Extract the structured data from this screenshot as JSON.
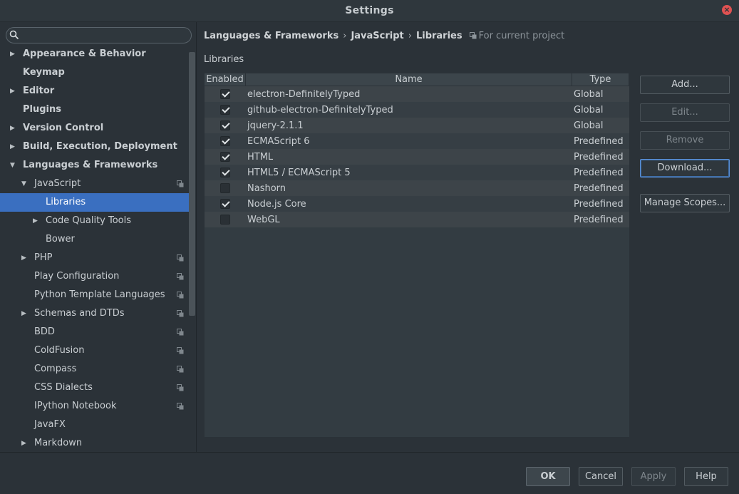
{
  "window": {
    "title": "Settings"
  },
  "sidebar": {
    "search": {
      "placeholder": "",
      "value": ""
    },
    "items": [
      {
        "label": "Appearance & Behavior",
        "bold": true,
        "level": 0,
        "arrow": "right",
        "copy": false
      },
      {
        "label": "Keymap",
        "bold": true,
        "level": 0,
        "arrow": "",
        "copy": false
      },
      {
        "label": "Editor",
        "bold": true,
        "level": 0,
        "arrow": "right",
        "copy": false
      },
      {
        "label": "Plugins",
        "bold": true,
        "level": 0,
        "arrow": "",
        "copy": false
      },
      {
        "label": "Version Control",
        "bold": true,
        "level": 0,
        "arrow": "right",
        "copy": false
      },
      {
        "label": "Build, Execution, Deployment",
        "bold": true,
        "level": 0,
        "arrow": "right",
        "copy": false
      },
      {
        "label": "Languages & Frameworks",
        "bold": true,
        "level": 0,
        "arrow": "down",
        "copy": false
      },
      {
        "label": "JavaScript",
        "bold": false,
        "level": 1,
        "arrow": "down",
        "copy": true
      },
      {
        "label": "Libraries",
        "bold": false,
        "level": 2,
        "arrow": "",
        "copy": false,
        "selected": true
      },
      {
        "label": "Code Quality Tools",
        "bold": false,
        "level": 2,
        "arrow": "right",
        "copy": false
      },
      {
        "label": "Bower",
        "bold": false,
        "level": 2,
        "arrow": "",
        "copy": false
      },
      {
        "label": "PHP",
        "bold": false,
        "level": 1,
        "arrow": "right",
        "copy": true
      },
      {
        "label": "Play Configuration",
        "bold": false,
        "level": 1,
        "arrow": "",
        "copy": true
      },
      {
        "label": "Python Template Languages",
        "bold": false,
        "level": 1,
        "arrow": "",
        "copy": true
      },
      {
        "label": "Schemas and DTDs",
        "bold": false,
        "level": 1,
        "arrow": "right",
        "copy": true
      },
      {
        "label": "BDD",
        "bold": false,
        "level": 1,
        "arrow": "",
        "copy": true
      },
      {
        "label": "ColdFusion",
        "bold": false,
        "level": 1,
        "arrow": "",
        "copy": true
      },
      {
        "label": "Compass",
        "bold": false,
        "level": 1,
        "arrow": "",
        "copy": true
      },
      {
        "label": "CSS Dialects",
        "bold": false,
        "level": 1,
        "arrow": "",
        "copy": true
      },
      {
        "label": "IPython Notebook",
        "bold": false,
        "level": 1,
        "arrow": "",
        "copy": true
      },
      {
        "label": "JavaFX",
        "bold": false,
        "level": 1,
        "arrow": "",
        "copy": false
      },
      {
        "label": "Markdown",
        "bold": false,
        "level": 1,
        "arrow": "right",
        "copy": false
      }
    ]
  },
  "breadcrumb": {
    "items": [
      "Languages & Frameworks",
      "JavaScript",
      "Libraries"
    ],
    "separator": "›",
    "scope": "For current project"
  },
  "main": {
    "section_label": "Libraries",
    "columns": {
      "enabled": "Enabled",
      "name": "Name",
      "type": "Type"
    },
    "rows": [
      {
        "enabled": true,
        "name": "electron-DefinitelyTyped",
        "type": "Global"
      },
      {
        "enabled": true,
        "name": "github-electron-DefinitelyTyped",
        "type": "Global"
      },
      {
        "enabled": true,
        "name": "jquery-2.1.1",
        "type": "Global"
      },
      {
        "enabled": true,
        "name": "ECMAScript 6",
        "type": "Predefined"
      },
      {
        "enabled": true,
        "name": "HTML",
        "type": "Predefined"
      },
      {
        "enabled": true,
        "name": "HTML5 / ECMAScript 5",
        "type": "Predefined"
      },
      {
        "enabled": false,
        "name": "Nashorn",
        "type": "Predefined"
      },
      {
        "enabled": true,
        "name": "Node.js Core",
        "type": "Predefined"
      },
      {
        "enabled": false,
        "name": "WebGL",
        "type": "Predefined"
      }
    ]
  },
  "actions": {
    "add": "Add...",
    "edit": "Edit...",
    "remove": "Remove",
    "download": "Download...",
    "manage_scopes": "Manage Scopes..."
  },
  "footer": {
    "ok": "OK",
    "cancel": "Cancel",
    "apply": "Apply",
    "help": "Help"
  },
  "colors": {
    "background": "#2b3238",
    "selection": "#3a6fc0",
    "close": "#e05252"
  }
}
